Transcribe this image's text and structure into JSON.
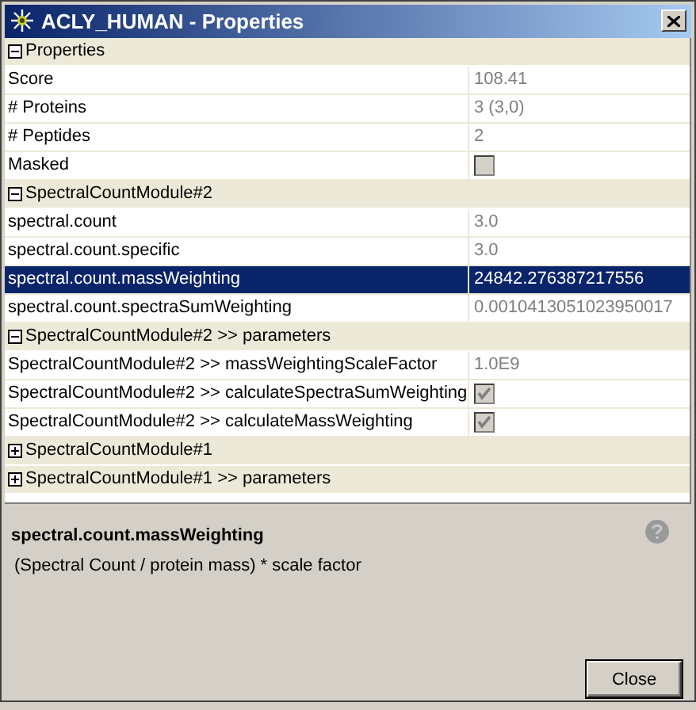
{
  "window": {
    "title": "ACLY_HUMAN - Properties"
  },
  "sections": [
    {
      "label": "Properties",
      "expanded": true,
      "rows": [
        {
          "name": "Score",
          "kind": "text",
          "value": "108.41",
          "selected": false
        },
        {
          "name": "# Proteins",
          "kind": "text",
          "value": "3 (3,0)",
          "selected": false
        },
        {
          "name": "# Peptides",
          "kind": "text",
          "value": "2",
          "selected": false
        },
        {
          "name": "Masked",
          "kind": "checkbox",
          "checked": false,
          "selected": false
        }
      ]
    },
    {
      "label": "SpectralCountModule#2",
      "expanded": true,
      "rows": [
        {
          "name": "spectral.count",
          "kind": "text",
          "value": "3.0",
          "selected": false
        },
        {
          "name": "spectral.count.specific",
          "kind": "text",
          "value": "3.0",
          "selected": false
        },
        {
          "name": "spectral.count.massWeighting",
          "kind": "text",
          "value": "24842.276387217556",
          "selected": true
        },
        {
          "name": "spectral.count.spectraSumWeighting",
          "kind": "text",
          "value": "0.0010413051023950017",
          "selected": false
        }
      ]
    },
    {
      "label": "SpectralCountModule#2 >> parameters",
      "expanded": true,
      "rows": [
        {
          "name": "SpectralCountModule#2 >> massWeightingScaleFactor",
          "kind": "text",
          "value": "1.0E9",
          "selected": false
        },
        {
          "name": "SpectralCountModule#2 >> calculateSpectraSumWeighting",
          "kind": "checkbox",
          "checked": true,
          "selected": false
        },
        {
          "name": "SpectralCountModule#2 >> calculateMassWeighting",
          "kind": "checkbox",
          "checked": true,
          "selected": false
        }
      ]
    },
    {
      "label": "SpectralCountModule#1",
      "expanded": false
    },
    {
      "label": "SpectralCountModule#1 >> parameters",
      "expanded": false
    }
  ],
  "help": {
    "title": "spectral.count.massWeighting",
    "description": "(Spectral Count / protein mass) * scale factor"
  },
  "buttons": [
    "Close"
  ]
}
